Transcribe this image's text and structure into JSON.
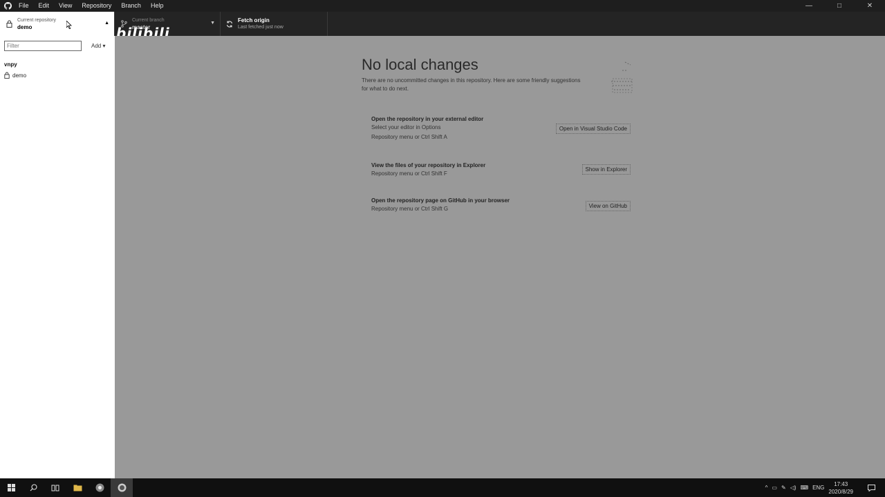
{
  "menubar": {
    "items": [
      "File",
      "Edit",
      "View",
      "Repository",
      "Branch",
      "Help"
    ],
    "window_controls": [
      "—",
      "□",
      "✕"
    ]
  },
  "toolbar": {
    "repo_label": "Current repository",
    "repo_name": "demo",
    "branch_label": "Current branch",
    "branch_name": "master",
    "fetch_title": "Fetch origin",
    "fetch_subtitle": "Last fetched just now"
  },
  "watermark": "bilibili",
  "sidebar": {
    "filter_placeholder": "Filter",
    "add_label": "Add",
    "group_label": "vnpy",
    "repos": [
      "demo"
    ]
  },
  "main": {
    "title": "No local changes",
    "intro": "There are no uncommitted changes in this repository. Here are some friendly suggestions for what to do next.",
    "actions": [
      {
        "title": "Open the repository in your external editor",
        "desc": "Select your editor in Options",
        "shortcut": "Repository menu or Ctrl Shift A",
        "button": "Open in Visual Studio Code"
      },
      {
        "title": "View the files of your repository in Explorer",
        "shortcut": "Repository menu or Ctrl Shift F",
        "button": "Show in Explorer"
      },
      {
        "title": "Open the repository page on GitHub in your browser",
        "shortcut": "Repository menu or Ctrl Shift G",
        "button": "View on GitHub"
      }
    ]
  },
  "taskbar": {
    "language": "ENG",
    "time": "17:43",
    "date": "2020/8/29"
  }
}
